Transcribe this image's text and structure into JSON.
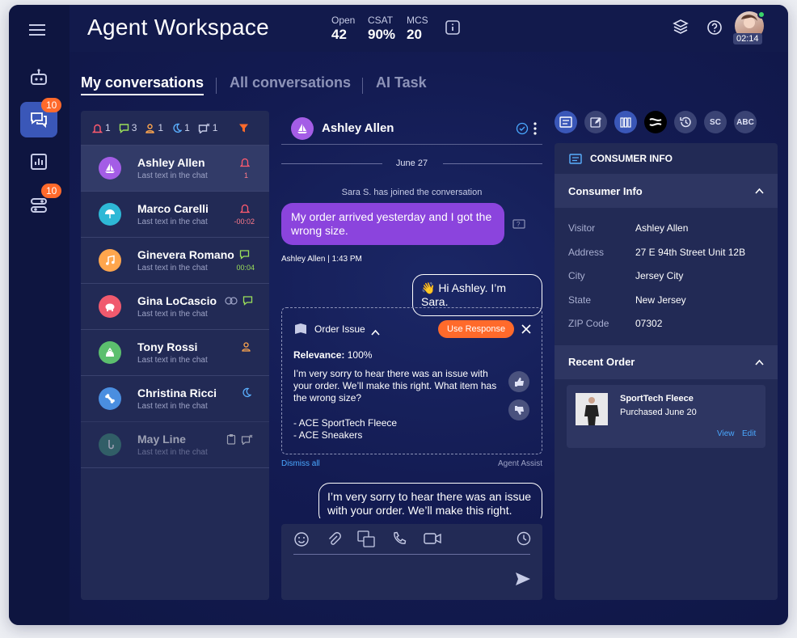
{
  "app": {
    "title": "Agent Workspace"
  },
  "stats": [
    {
      "label": "Open",
      "value": "42"
    },
    {
      "label": "CSAT",
      "value": "90%"
    },
    {
      "label": "MCS",
      "value": "20"
    }
  ],
  "profile": {
    "timer": "02:14"
  },
  "rail": {
    "messages_badge": "10",
    "tasks_badge": "10"
  },
  "tabs": [
    "My conversations",
    "All conversations",
    "AI Task"
  ],
  "filters": [
    {
      "icon": "bell-icon",
      "count": "1",
      "color": "#ff5a6e"
    },
    {
      "icon": "chat-icon",
      "count": "3",
      "color": "#9be05a"
    },
    {
      "icon": "person-icon",
      "count": "1",
      "color": "#ffa64d"
    },
    {
      "icon": "moon-icon",
      "count": "1",
      "color": "#5ab0ff"
    },
    {
      "icon": "chat-x-icon",
      "count": "1",
      "color": "#c6cbe6"
    }
  ],
  "conversations": [
    {
      "name": "Ashley Allen",
      "sub": "Last text in the chat",
      "status": "1",
      "avatar_color": "#a45de6",
      "icon": "sailboat-icon"
    },
    {
      "name": "Marco Carelli",
      "sub": "Last text in the chat",
      "status": "-00:02",
      "avatar_color": "#2eb8d6",
      "icon": "umbrella-icon"
    },
    {
      "name": "Ginevera Romano",
      "sub": "Last text in the chat",
      "status": "00:04",
      "avatar_color": "#ffa64d",
      "icon": "music-icon"
    },
    {
      "name": "Gina LoCascio",
      "sub": "Last text in the chat",
      "status": "",
      "avatar_color": "#f05a6e",
      "icon": "piggy-icon"
    },
    {
      "name": "Tony Rossi",
      "sub": "Last text in the chat",
      "status": "",
      "avatar_color": "#5cbf6e",
      "icon": "bag-icon"
    },
    {
      "name": "Christina Ricci",
      "sub": "Last text in the chat",
      "status": "",
      "avatar_color": "#4a8ee0",
      "icon": "bone-icon"
    },
    {
      "name": "May Line",
      "sub": "Last text in the chat",
      "status": "",
      "avatar_color": "#3f8a76",
      "icon": "sax-icon"
    }
  ],
  "chat": {
    "header_name": "Ashley Allen",
    "date": "June 27",
    "system_msg": "Sara S. has joined the conversation",
    "msg_in": "My order arrived yesterday and I got the wrong size.",
    "msg_in_meta": "Ashley Allen  |  1:43 PM",
    "msg_out1": "👋 Hi Ashley. I’m Sara.",
    "assist": {
      "title": "Order Issue",
      "button": "Use Response",
      "relevance_label": "Relevance:",
      "relevance_value": "100%",
      "body": "I’m very sorry to hear there was an issue with your order. We’ll make this right. What item has the wrong size?",
      "item1": "- ACE SportTech Fleece",
      "item2": "- ACE Sneakers",
      "dismiss": "Dismiss all",
      "source": "Agent Assist"
    },
    "msg_out2": "I’m very sorry to hear there was an issue with your order. We’ll make this right."
  },
  "panel": {
    "tools": [
      "SC",
      "ABC"
    ],
    "header": "CONSUMER INFO",
    "consumer_title": "Consumer Info",
    "fields": [
      {
        "k": "Visitor",
        "v": "Ashley Allen"
      },
      {
        "k": "Address",
        "v": "27 E 94th Street Unit 12B"
      },
      {
        "k": "City",
        "v": "Jersey City"
      },
      {
        "k": "State",
        "v": "New Jersey"
      },
      {
        "k": "ZIP Code",
        "v": "07302"
      }
    ],
    "recent_title": "Recent Order",
    "order": {
      "name": "SportTech Fleece",
      "date": "Purchased June 20",
      "view": "View",
      "edit": "Edit"
    }
  }
}
